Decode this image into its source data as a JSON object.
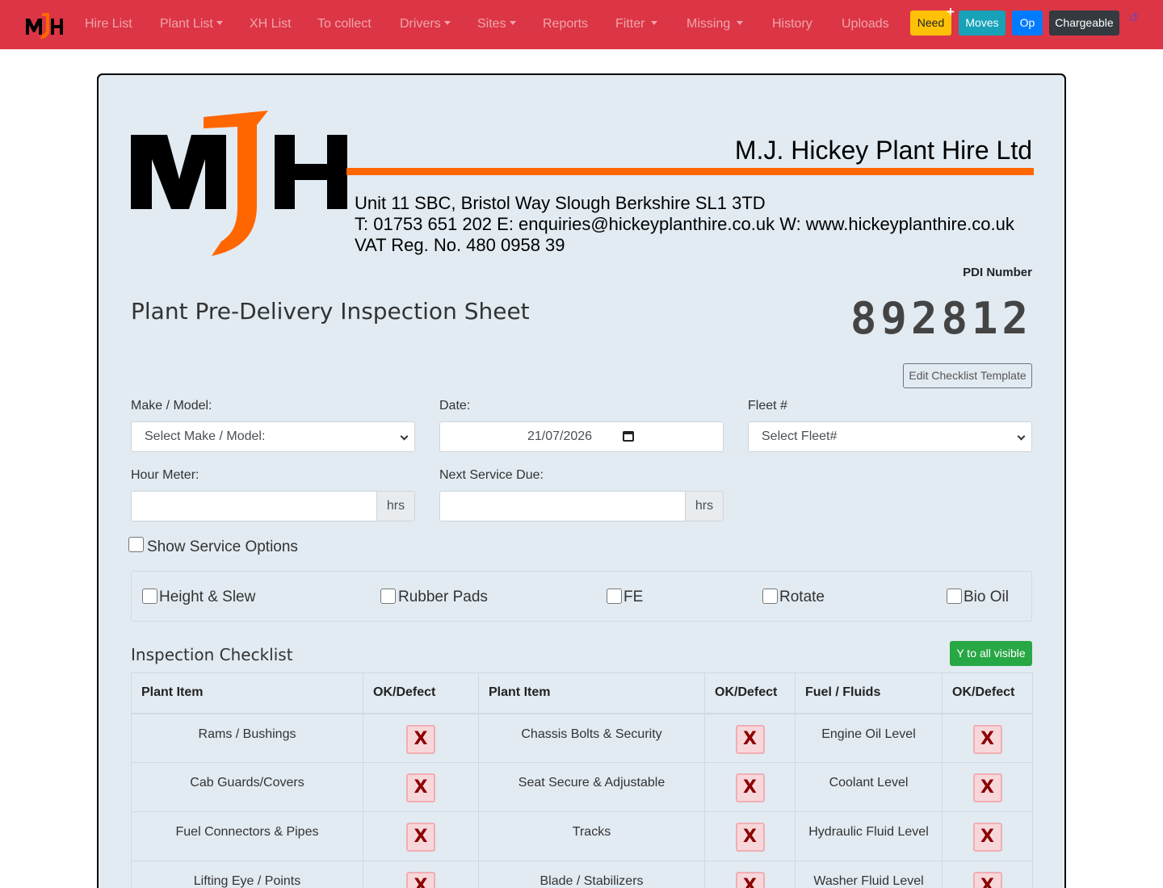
{
  "nav": {
    "brand": "MJH",
    "items": [
      {
        "label": "Hire List",
        "dropdown": false
      },
      {
        "label": "Plant List",
        "dropdown": true
      },
      {
        "label": "XH List",
        "dropdown": false
      },
      {
        "label": "To collect",
        "dropdown": false
      },
      {
        "label": "Drivers",
        "dropdown": true
      },
      {
        "label": "Sites",
        "dropdown": true
      },
      {
        "label": "Reports",
        "dropdown": false
      },
      {
        "label": "Fitter",
        "dropdown": true
      },
      {
        "label": "Missing",
        "dropdown": true
      },
      {
        "label": "History",
        "dropdown": false
      },
      {
        "label": "Uploads",
        "dropdown": false
      }
    ],
    "buttons": [
      {
        "label": "Need",
        "color": "#ffc107",
        "text_color": "#212529"
      },
      {
        "label": "Moves",
        "color": "#17a2b8",
        "text_color": "#ffffff"
      },
      {
        "label": "Op",
        "color": "#007bff",
        "text_color": "#ffffff"
      },
      {
        "label": "Chargeable",
        "color": "#343a40",
        "text_color": "#ffffff"
      }
    ],
    "plus_icon": "plus-icon",
    "history_icon": "history-icon",
    "bg_color": "#dc3545"
  },
  "header": {
    "company_name": "M.J. Hickey Plant Hire Ltd",
    "address": "Unit 11  SBC, Bristol Way Slough Berkshire SL1 3TD",
    "contact": "T: 01753 651 202   E: enquiries@hickeyplanthire.co.uk   W: www.hickeyplanthire.co.uk",
    "vat": "VAT Reg. No. 480 0958 39",
    "accent_color": "#ff6600"
  },
  "pdi": {
    "label": "PDI Number",
    "number": "892812"
  },
  "page_title": "Plant Pre-Delivery Inspection Sheet",
  "edit_template_label": "Edit Checklist Template",
  "form": {
    "make_model_label": "Make / Model:",
    "make_model_value": "Select Make / Model:",
    "date_label": "Date:",
    "date_value": "21/07/2026",
    "fleet_label": "Fleet #",
    "fleet_value": "Select Fleet#",
    "hour_meter_label": "Hour Meter:",
    "hour_meter_value": "",
    "hour_meter_unit": "hrs",
    "next_service_label": "Next Service Due:",
    "next_service_value": "",
    "next_service_unit": "hrs",
    "show_service_label": "Show Service Options",
    "show_service_checked": false
  },
  "options": [
    {
      "label": "Height & Slew",
      "checked": false
    },
    {
      "label": "Rubber Pads",
      "checked": false
    },
    {
      "label": "FE",
      "checked": false
    },
    {
      "label": "Rotate",
      "checked": false
    },
    {
      "label": "Bio Oil",
      "checked": false
    }
  ],
  "checklist": {
    "title": "Inspection Checklist",
    "all_yes_label": "Y to all visible",
    "headers": [
      "Plant Item",
      "OK/Defect",
      "Plant Item",
      "OK/Defect",
      "Fuel / Fluids",
      "OK/Defect"
    ],
    "status_mark": "X",
    "rows": [
      [
        "Rams / Bushings",
        "Chassis Bolts & Security",
        "Engine Oil Level"
      ],
      [
        "Cab Guards/Covers",
        "Seat Secure & Adjustable",
        "Coolant Level"
      ],
      [
        "Fuel Connectors & Pipes",
        "Tracks",
        "Hydraulic Fluid Level"
      ],
      [
        "Lifting Eye / Points",
        "Blade / Stabilizers",
        "Washer Fluid Level"
      ]
    ]
  }
}
